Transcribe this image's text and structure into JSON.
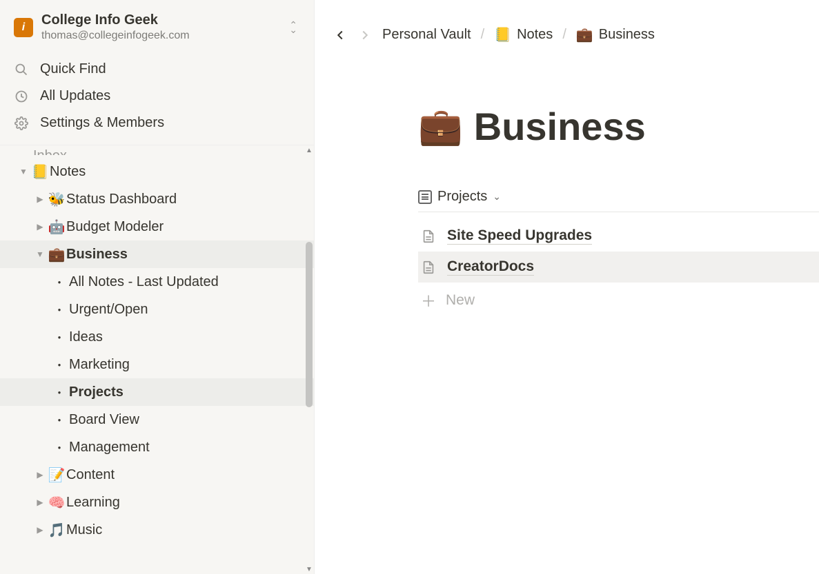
{
  "workspace": {
    "name": "College Info Geek",
    "email": "thomas@collegeinfogeek.com",
    "logo_text": "i"
  },
  "topnav": {
    "quick_find": "Quick Find",
    "all_updates": "All Updates",
    "settings": "Settings & Members"
  },
  "tree": {
    "clipped_top": "Inbox",
    "notes": {
      "label": "Notes",
      "emoji": "📒",
      "children": {
        "status": {
          "label": "Status Dashboard",
          "emoji": "🐝"
        },
        "budget": {
          "label": "Budget Modeler",
          "emoji": "🤖"
        },
        "business": {
          "label": "Business",
          "emoji": "💼",
          "children": {
            "allnotes": "All Notes - Last Updated",
            "urgent": "Urgent/Open",
            "ideas": "Ideas",
            "marketing": "Marketing",
            "projects": "Projects",
            "board": "Board View",
            "management": "Management"
          }
        },
        "content": {
          "label": "Content",
          "emoji": "📝"
        },
        "learning": {
          "label": "Learning",
          "emoji": "🧠"
        },
        "music": {
          "label": "Music",
          "emoji": "🎵"
        }
      }
    }
  },
  "breadcrumbs": {
    "root": "Personal Vault",
    "notes": {
      "label": "Notes",
      "emoji": "📒"
    },
    "current": {
      "label": "Business",
      "emoji": "💼"
    }
  },
  "page": {
    "title": "Business",
    "icon": "💼"
  },
  "view": {
    "name": "Projects"
  },
  "rows": {
    "r1": "Site Speed Upgrades",
    "r2": "CreatorDocs",
    "new": "New"
  }
}
